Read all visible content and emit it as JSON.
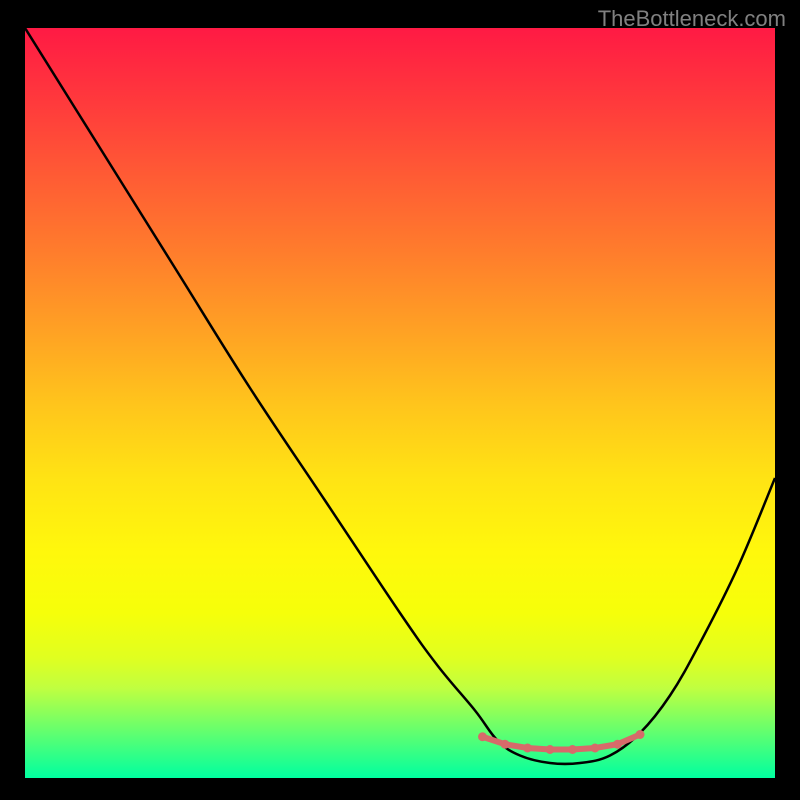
{
  "watermark": "TheBottleneck.com",
  "chart_data": {
    "type": "line",
    "title": "",
    "xlabel": "",
    "ylabel": "",
    "xlim": [
      0,
      100
    ],
    "ylim": [
      0,
      100
    ],
    "series": [
      {
        "name": "bottleneck-curve",
        "x": [
          0,
          10,
          20,
          30,
          40,
          50,
          55,
          60,
          63,
          66,
          70,
          74,
          78,
          82,
          86,
          90,
          95,
          100
        ],
        "values": [
          100,
          84,
          68,
          52,
          37,
          22,
          15,
          9,
          5,
          3,
          2,
          2,
          3,
          6,
          11,
          18,
          28,
          40
        ]
      }
    ],
    "highlight_region": {
      "name": "optimal-zone",
      "color": "#d76a6a",
      "x_points": [
        61,
        64,
        67,
        70,
        73,
        76,
        79,
        82
      ],
      "y_points": [
        5.5,
        4.5,
        4.0,
        3.8,
        3.8,
        4.0,
        4.5,
        5.8
      ]
    },
    "gradient_stops": [
      {
        "pos": 0,
        "color": "#ff1a44"
      },
      {
        "pos": 50,
        "color": "#ffc41c"
      },
      {
        "pos": 80,
        "color": "#f6ff0a"
      },
      {
        "pos": 100,
        "color": "#00ffa0"
      }
    ]
  }
}
